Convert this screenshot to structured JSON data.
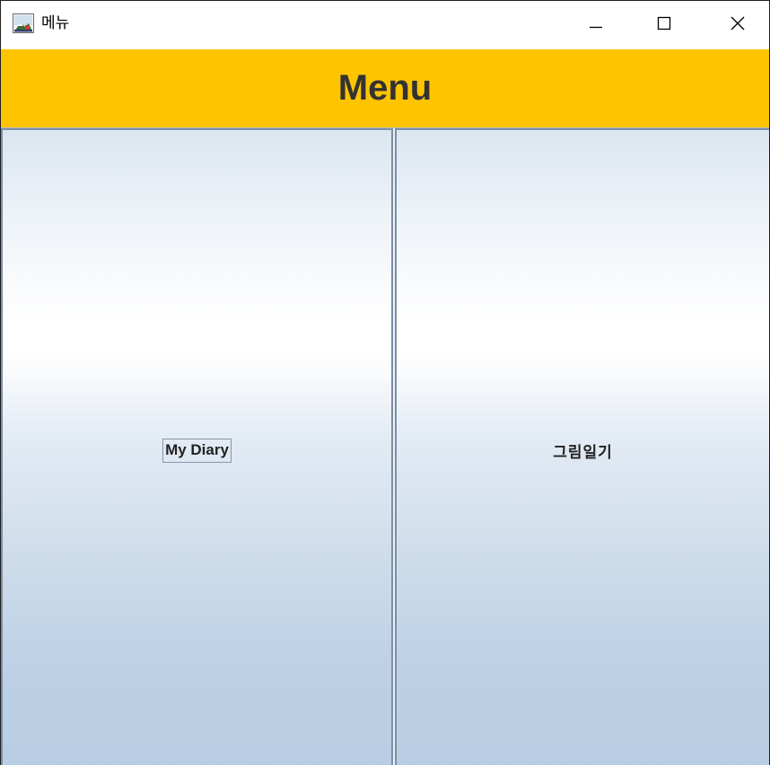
{
  "window": {
    "title": "메뉴",
    "app_icon": "java-app-icon",
    "controls": {
      "minimize_icon": "minimize-icon",
      "maximize_icon": "maximize-icon",
      "close_icon": "close-icon"
    }
  },
  "header": {
    "title": "Menu",
    "background_color": "#ffc400",
    "text_color": "#333333"
  },
  "menu": {
    "buttons": [
      {
        "label": "My Diary",
        "focused": true
      },
      {
        "label": "그림일기",
        "focused": false
      }
    ],
    "gradient_colors": [
      "#dce6f0",
      "#ffffff",
      "#b8cde3"
    ],
    "border_color": "#7a8ea6"
  }
}
